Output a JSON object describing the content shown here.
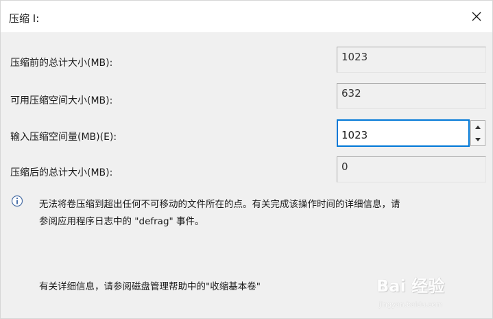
{
  "window": {
    "title": "压缩 I:",
    "close_icon": "close-icon"
  },
  "rows": {
    "total_before_label": "压缩前的总计大小(MB):",
    "total_before_value": "1023",
    "available_label": "可用压缩空间大小(MB):",
    "available_value": "632",
    "enter_amount_label": "输入压缩空间量(MB)(E):",
    "enter_amount_value": "1023",
    "total_after_label": "压缩后的总计大小(MB):",
    "total_after_value": "0"
  },
  "info": {
    "icon": "info-icon",
    "message_line1": "无法将卷压缩到超出任何不可移动的文件所在的点。有关完成该操作时间的详细信息，请",
    "message_line2": "参阅应用程序日志中的 \"defrag\" 事件。"
  },
  "help": {
    "text": "有关详细信息，请参阅磁盘管理帮助中的\"收缩基本卷\""
  },
  "watermark": {
    "brand": "Bai 经验",
    "url": "jingyan.baidu.com"
  },
  "colors": {
    "focus_border": "#0078d7",
    "dialog_bg": "#f0f0f0",
    "titlebar_bg": "#ffffff"
  }
}
